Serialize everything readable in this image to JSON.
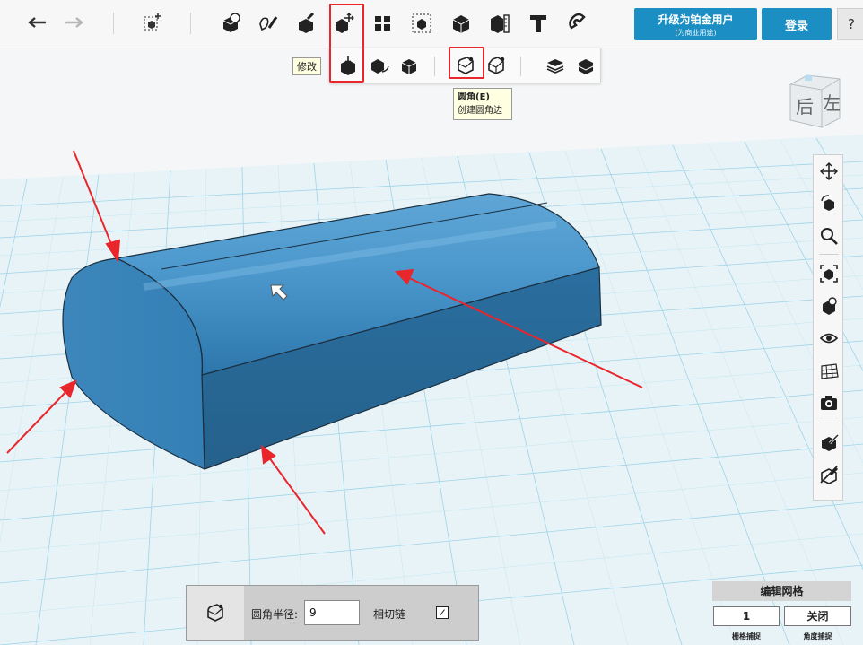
{
  "toolbar": {
    "tooltip_modify": "修改",
    "upgrade_label": "升级为铂金用户",
    "upgrade_sub": "(为商业用途)",
    "login_label": "登录",
    "help_label": "?"
  },
  "submenu": {
    "fillet_tooltip_title": "圆角(E)",
    "fillet_tooltip_desc": "创建圆角边"
  },
  "viewcube": {
    "face_back": "后",
    "face_left": "左"
  },
  "fillet_panel": {
    "radius_label": "圆角半径:",
    "radius_value": "9",
    "tangent_chain_label": "相切链",
    "tangent_chain_checked": "✓"
  },
  "grid_panel": {
    "title": "编辑网格",
    "snap_value": "1",
    "angle_value": "关闭",
    "snap_caption": "栅格捕捉",
    "angle_caption": "角度捕捉"
  },
  "colors": {
    "accent": "#1b8fc4",
    "highlight": "#e8262c",
    "model": "#2d7fb8",
    "grid": "#8fd0e6"
  }
}
